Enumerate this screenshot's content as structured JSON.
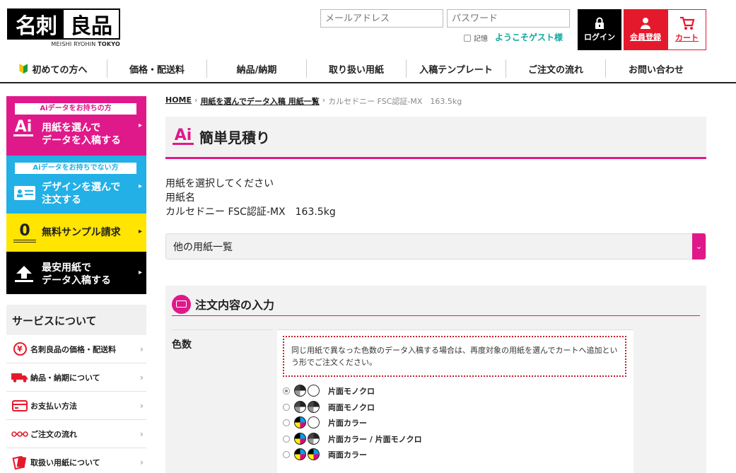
{
  "header": {
    "logo_left": "名刺",
    "logo_right": "良品",
    "logo_sub_plain": "MEISHI RYOHIN",
    "logo_sub_bold": "TOKYO",
    "email_placeholder": "メールアドレス",
    "password_placeholder": "パスワード",
    "remember_label": "記憶",
    "welcome": "ようこそゲスト様",
    "login_label": "ログイン",
    "register_label": "会員登録",
    "cart_label": "カート"
  },
  "nav": {
    "items": [
      "初めての方へ",
      "価格・配送料",
      "納品/納期",
      "取り扱い用紙",
      "入稿テンプレート",
      "ご注文の流れ",
      "お問い合わせ"
    ]
  },
  "sidebar": {
    "banners": [
      {
        "tag": "Aiデータをお持ちの方",
        "line1": "用紙を選んで",
        "line2": "データを入稿する",
        "icon": "Ai"
      },
      {
        "tag": "Aiデータをお持ちでない方",
        "line1": "デザインを選んで",
        "line2": "注文する"
      },
      {
        "line1": "無料サンプル請求",
        "icon": "0"
      },
      {
        "line1": "最安用紙で",
        "line2": "データ入稿する"
      }
    ],
    "services_title": "サービスについて",
    "services": [
      {
        "label": "名刺良品の価格・配送料",
        "icon_text": "¥"
      },
      {
        "label": "納品・納期について"
      },
      {
        "label": "お支払い方法"
      },
      {
        "label": "ご注文の流れ"
      },
      {
        "label": "取扱い用紙について"
      }
    ],
    "chevron": "›"
  },
  "breadcrumb": {
    "home": "HOME",
    "parent": "用紙を選んでデータ入稿 用紙一覧",
    "current": "カルセドニー FSC認証-MX　163.5kg",
    "sep": "›"
  },
  "main": {
    "icon_text": "Ai",
    "title": "簡単見積り",
    "prompt": "用紙を選択してください",
    "paper_name_label": "用紙名",
    "paper_name": "カルセドニー FSC認証-MX　163.5kg",
    "select_label": "他の用紙一覧",
    "select_arrow": "⌄"
  },
  "order": {
    "title": "注文内容の入力",
    "color_label": "色数",
    "note": "同じ用紙で異なった色数のデータ入稿する場合は、再度対象の用紙を選んでカートへ追加という形でご注文ください。",
    "options": [
      {
        "label": "片面モノクロ",
        "selected": true
      },
      {
        "label": "両面モノクロ",
        "selected": false
      },
      {
        "label": "片面カラー",
        "selected": false
      },
      {
        "label": "片面カラー / 片面モノクロ",
        "selected": false
      },
      {
        "label": "両面カラー",
        "selected": false
      }
    ]
  },
  "colors": {
    "accent_pink": "#e0198a",
    "accent_blue": "#22b0e6",
    "accent_yellow": "#ffe500",
    "accent_red": "#e5192c",
    "teal": "#13a89e"
  }
}
